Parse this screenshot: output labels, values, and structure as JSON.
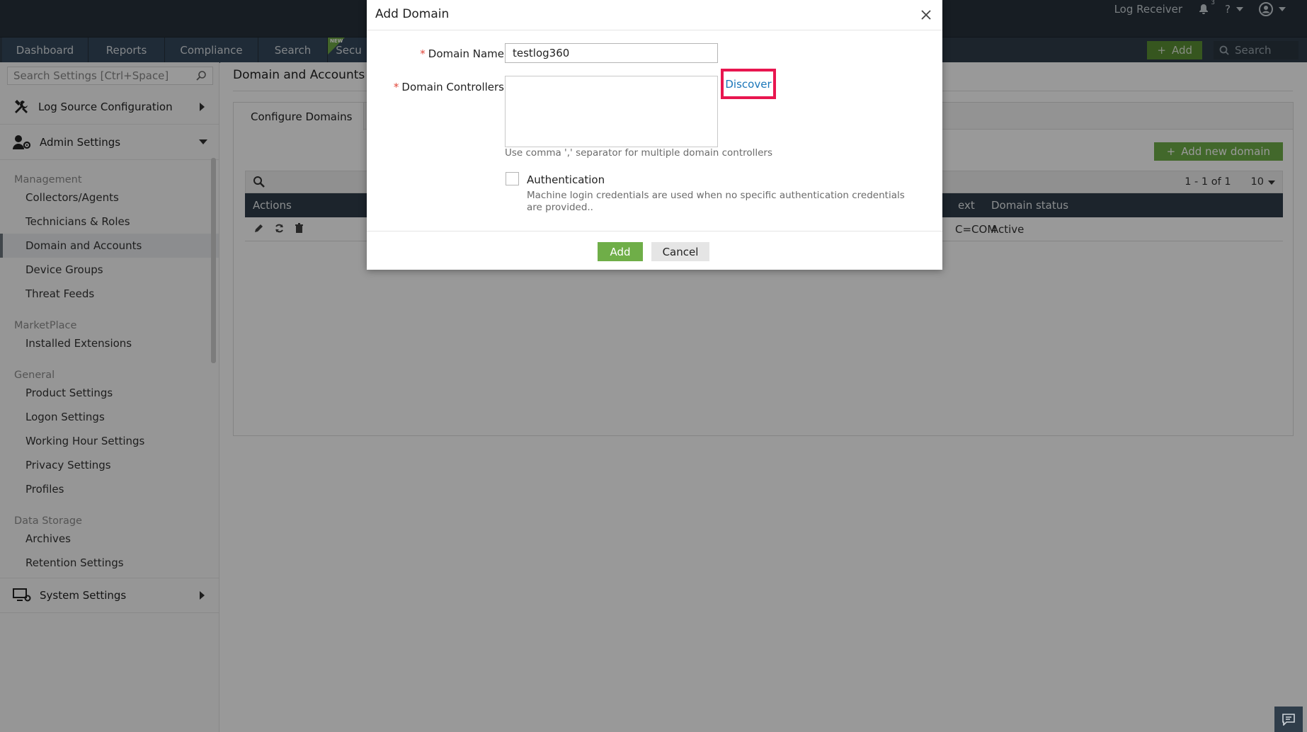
{
  "topbar": {
    "log_receiver": "Log Receiver",
    "notification_count": "3",
    "help_label": "?"
  },
  "nav": {
    "tabs": [
      "Dashboard",
      "Reports",
      "Compliance",
      "Search",
      "Secu"
    ],
    "new_badge": "NEW",
    "add_label": "Add",
    "search_placeholder": "Search"
  },
  "sidebar": {
    "search_placeholder": "Search Settings [Ctrl+Space]",
    "log_source": "Log Source Configuration",
    "admin_settings": "Admin Settings",
    "groups": {
      "management": "Management",
      "marketplace": "MarketPlace",
      "general": "General",
      "data_storage": "Data Storage"
    },
    "items": {
      "collectors": "Collectors/Agents",
      "technicians": "Technicians & Roles",
      "domain_accounts": "Domain and Accounts",
      "device_groups": "Device Groups",
      "threat_feeds": "Threat Feeds",
      "installed_extensions": "Installed Extensions",
      "product_settings": "Product Settings",
      "logon_settings": "Logon Settings",
      "working_hour": "Working Hour Settings",
      "privacy_settings": "Privacy Settings",
      "profiles": "Profiles",
      "archives": "Archives",
      "retention": "Retention Settings"
    },
    "system_settings": "System Settings"
  },
  "content": {
    "page_title": "Domain and Accounts",
    "tab_configure": "Configure Domains",
    "add_new_domain": "Add new domain",
    "pager_text": "1 - 1 of 1",
    "page_size": "10",
    "columns": {
      "actions": "Actions",
      "context_partial": "ext",
      "domain_status": "Domain status"
    },
    "row": {
      "context_partial": "C=COM",
      "status": "Active"
    }
  },
  "modal": {
    "title": "Add Domain",
    "domain_name_label": "Domain Name",
    "domain_name_value": "testlog360",
    "domain_controllers_label": "Domain Controllers",
    "discover_label": "Discover",
    "hint": "Use comma ',' separator for multiple domain controllers",
    "auth_label": "Authentication",
    "auth_desc": "Machine login credentials are used when no specific authentication credentials are provided..",
    "add_label": "Add",
    "cancel_label": "Cancel"
  },
  "colors": {
    "nav_dark": "#2f3d4a",
    "accent_green": "#6fae48",
    "highlight_red": "#e8164f",
    "link_blue": "#1a76b9"
  }
}
